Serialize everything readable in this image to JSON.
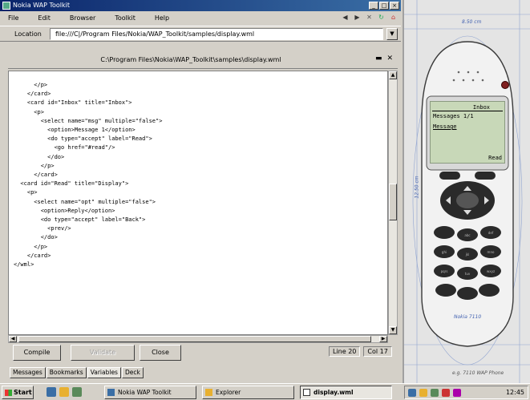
{
  "window": {
    "title": "Nokia WAP Toolkit",
    "controls": [
      "_",
      "□",
      "×"
    ]
  },
  "menu": [
    "File",
    "Edit",
    "Browser",
    "Toolkit",
    "Help"
  ],
  "toolbar_icons": [
    "back-icon",
    "forward-icon",
    "stop-icon",
    "reload-icon",
    "home-icon"
  ],
  "address": {
    "label": "Location",
    "value": "file:///C|/Program Files/Nokia/WAP_Toolkit/samples/display.wml"
  },
  "document": {
    "title": "C:\\Program Files\\Nokia\\WAP_Toolkit\\samples\\display.wml",
    "code_lines": [
      "      </p>",
      "    </card>",
      "    <card id=\"Inbox\" title=\"Inbox\">",
      "      <p>",
      "        <select name=\"msg\" multiple=\"false\">",
      "          <option>Message 1</option>",
      "          <do type=\"accept\" label=\"Read\">",
      "            <go href=\"#read\"/>",
      "          </do>",
      "        </p>",
      "      </card>",
      "  <card id=\"Read\" title=\"Display\">",
      "    <p>",
      "      <select name=\"opt\" multiple=\"false\">",
      "        <option>Reply</option>",
      "        <do type=\"accept\" label=\"Back\">",
      "          <prev/>",
      "        </do>",
      "      </p>",
      "    </card>",
      "</wml>"
    ]
  },
  "buttons": {
    "compile": "Compile",
    "validate": "Validate",
    "close": "Close"
  },
  "position": {
    "line": "Line 20",
    "col": "Col 17"
  },
  "tabs": [
    "Messages",
    "Bookmarks",
    "Variables",
    "Deck"
  ],
  "phone": {
    "screen_header": "Inbox",
    "line1": "Messages 1/1",
    "line2": "Message",
    "softkey": "Read",
    "dim_top": "8.50 cm",
    "dim_side": "12.50 cm",
    "dim_bottom": "Nokia 7110",
    "caption": "e.g. 7110 WAP Phone"
  },
  "taskbar": {
    "start": "Start",
    "tasks": [
      "Nokia WAP Toolkit",
      "Explorer",
      "display.wml"
    ],
    "clock": "12:45"
  }
}
